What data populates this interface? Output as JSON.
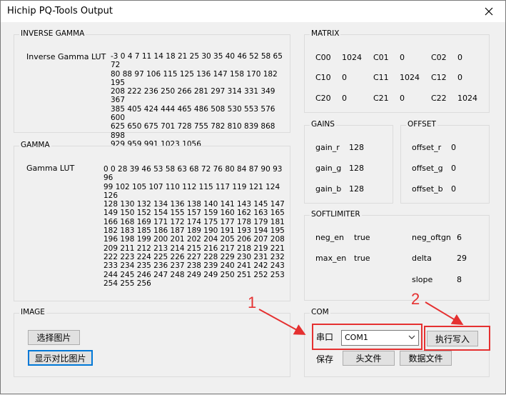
{
  "window": {
    "title": "Hichip PQ-Tools Output"
  },
  "inverse_gamma": {
    "group_label": "INVERSE GAMMA",
    "lut_label": "Inverse Gamma LUT",
    "lut_values": "-3 0 4 7 11 14 18 21 25 30 35 40 46 52 58 65 72\n80 88 97 106 115 125 136 147 158 170 182 195\n208 222 236 250 266 281 297 314 331 349 367\n385 405 424 444 465 486 508 530 553 576 600\n625 650 675 701 728 755 782 810 839 868 898\n929 959 991 1023 1056"
  },
  "gamma": {
    "group_label": "GAMMA",
    "lut_label": "Gamma LUT",
    "lut_values": "0 0 28 39 46 53 58 63 68 72 76 80 84 87 90 93 96\n99 102 105 107 110 112 115 117 119 121 124 126\n128 130 132 134 136 138 140 141 143 145 147\n149 150 152 154 155 157 159 160 162 163 165\n166 168 169 171 172 174 175 177 178 179 181\n182 183 185 186 187 189 190 191 193 194 195\n196 198 199 200 201 202 204 205 206 207 208\n209 211 212 213 214 215 216 217 218 219 221\n222 223 224 225 226 227 228 229 230 231 232\n233 234 235 236 237 238 239 240 241 242 243\n244 245 246 247 248 249 249 250 251 252 253\n254 255 256"
  },
  "matrix": {
    "group_label": "MATRIX",
    "cells": [
      {
        "label": "C00",
        "value": "1024"
      },
      {
        "label": "C01",
        "value": "0"
      },
      {
        "label": "C02",
        "value": "0"
      },
      {
        "label": "C10",
        "value": "0"
      },
      {
        "label": "C11",
        "value": "1024"
      },
      {
        "label": "C12",
        "value": "0"
      },
      {
        "label": "C20",
        "value": "0"
      },
      {
        "label": "C21",
        "value": "0"
      },
      {
        "label": "C22",
        "value": "1024"
      }
    ]
  },
  "gains": {
    "group_label": "GAINS",
    "rows": [
      {
        "label": "gain_r",
        "value": "128"
      },
      {
        "label": "gain_g",
        "value": "128"
      },
      {
        "label": "gain_b",
        "value": "128"
      }
    ]
  },
  "offset": {
    "group_label": "OFFSET",
    "rows": [
      {
        "label": "offset_r",
        "value": "0"
      },
      {
        "label": "offset_g",
        "value": "0"
      },
      {
        "label": "offset_b",
        "value": "0"
      }
    ]
  },
  "softlimiter": {
    "group_label": "SOFTLIMITER",
    "neg_en_label": "neg_en",
    "neg_en_value": "true",
    "max_en_label": "max_en",
    "max_en_value": "true",
    "neg_oftgn_label": "neg_oftgn",
    "neg_oftgn_value": "6",
    "delta_label": "delta",
    "delta_value": "29",
    "slope_label": "slope",
    "slope_value": "8"
  },
  "image": {
    "group_label": "IMAGE",
    "select_button": "选择图片",
    "compare_button": "显示对比图片"
  },
  "com": {
    "group_label": "COM",
    "port_label": "串口",
    "port_selected": "COM1",
    "write_button": "执行写入",
    "save_label": "保存",
    "header_file_button": "头文件",
    "data_file_button": "数据文件"
  },
  "annotations": {
    "marker_1": "1",
    "marker_2": "2",
    "color": "#e53030"
  }
}
